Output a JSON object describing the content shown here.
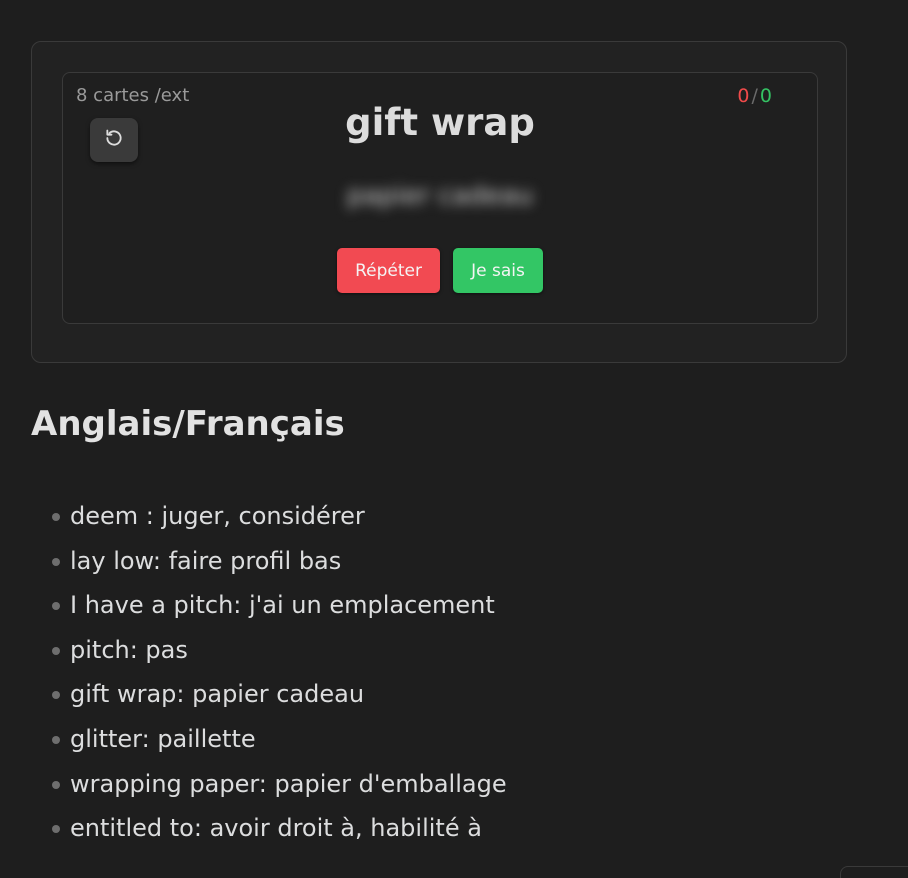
{
  "flashcard": {
    "count_label": "8 cartes /ext",
    "score": {
      "wrong": "0",
      "separator": "/",
      "right": "0"
    },
    "word": "gift wrap",
    "answer": "papier cadeau",
    "buttons": {
      "repeat": "Répéter",
      "know": "Je sais"
    },
    "icons": {
      "reset": "rotate-ccw-icon"
    },
    "colors": {
      "repeat": "#f24a52",
      "know": "#33c665",
      "wrong": "#ef4a4a",
      "right": "#34c163"
    }
  },
  "section": {
    "title": "Anglais/Français",
    "items": [
      "deem : juger, considérer",
      "lay low: faire profil bas",
      "I have a pitch: j'ai un emplacement",
      "pitch: pas",
      "gift wrap: papier cadeau",
      "glitter: paillette",
      "wrapping paper: papier d'emballage",
      "entitled to: avoir droit à, habilité à"
    ]
  }
}
